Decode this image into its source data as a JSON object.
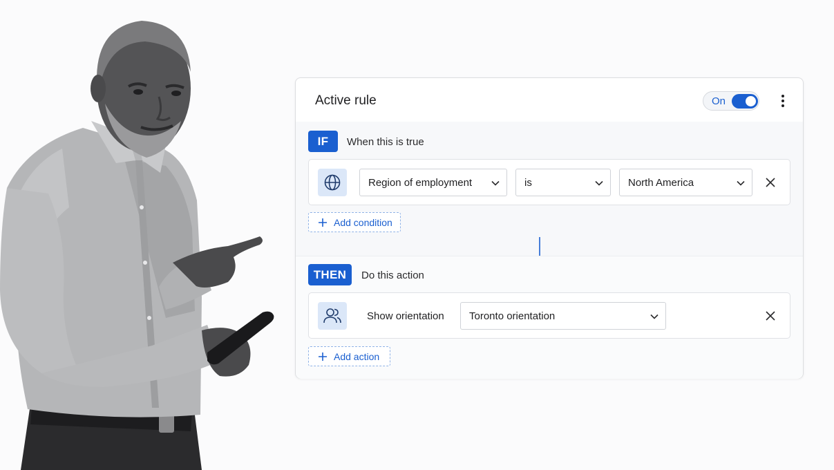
{
  "card": {
    "title": "Active rule",
    "toggle": {
      "label": "On",
      "state": "on"
    },
    "menu_icon": "more-vertical-icon"
  },
  "if_section": {
    "tag": "IF",
    "caption": "When this is true",
    "condition": {
      "icon": "globe-icon",
      "field": "Region of employment",
      "operator": "is",
      "value": "North America",
      "remove_icon": "close-icon"
    },
    "add_label": "Add condition"
  },
  "flow_icon": "arrow-down-icon",
  "then_section": {
    "tag": "THEN",
    "caption": "Do this action",
    "action": {
      "icon": "people-icon",
      "label": "Show orientation",
      "value": "Toronto orientation",
      "remove_icon": "close-icon"
    },
    "add_label": "Add action"
  },
  "colors": {
    "accent": "#1a5fd0",
    "icon_bg": "#dbe7f8",
    "card_border": "#dcdde0"
  }
}
